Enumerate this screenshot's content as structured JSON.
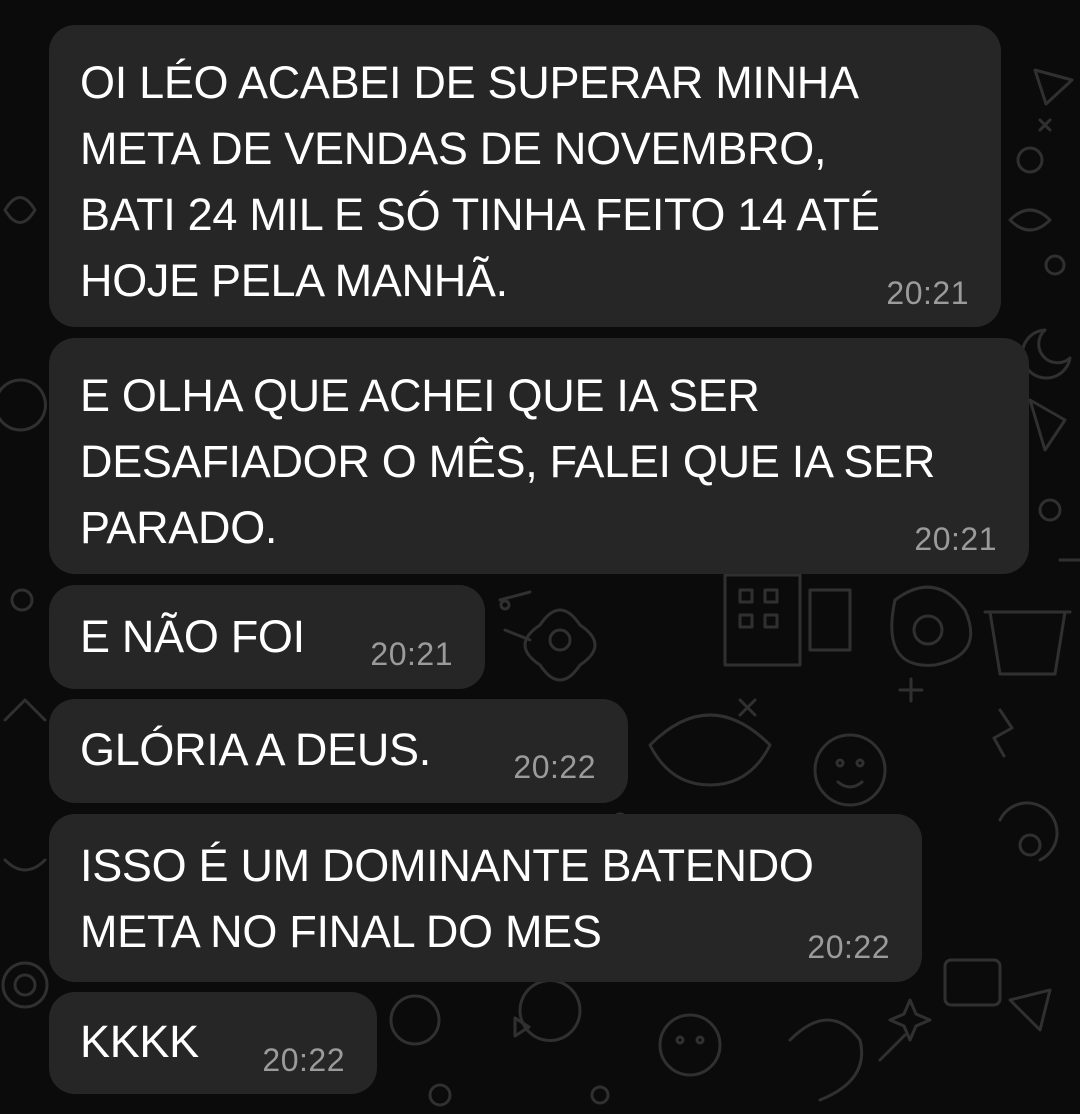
{
  "conversation": {
    "messages": [
      {
        "text": "OI LÉO ACABEI DE SUPERAR MINHA\nMETA DE VENDAS DE NOVEMBRO,\nBATI 24 MIL E SÓ TINHA FEITO 14 ATÉ\nHOJE PELA MANHÃ.",
        "time": "20:21"
      },
      {
        "text": "E OLHA QUE ACHEI QUE IA SER\nDESAFIADOR O MÊS, FALEI QUE IA SER\nPARADO.",
        "time": "20:21"
      },
      {
        "text": "E NÃO FOI",
        "time": "20:21"
      },
      {
        "text": "GLÓRIA A DEUS.",
        "time": "20:22"
      },
      {
        "text": "ISSO É UM DOMINANTE BATENDO\nMETA NO FINAL DO MES",
        "time": "20:22"
      },
      {
        "text": "KKKK",
        "time": "20:22"
      }
    ]
  },
  "colors": {
    "background": "#0b0b0b",
    "bubble": "#262626",
    "text": "#ffffff",
    "timestamp": "#9b9b9b",
    "doodle": "#2e2e2e"
  },
  "icons": [
    "chat-wallpaper-doodles",
    "bubble-tail-icon"
  ]
}
